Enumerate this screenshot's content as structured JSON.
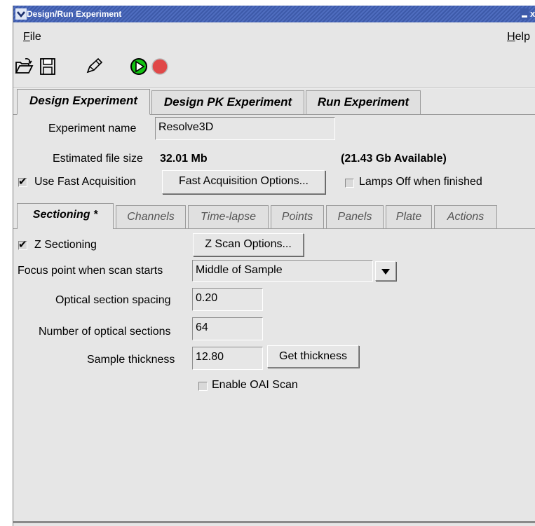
{
  "window": {
    "title": "Design/Run Experiment"
  },
  "menu": {
    "file": "File",
    "help": "Help"
  },
  "toolbar": {
    "icons": [
      "open-folder-icon",
      "save-icon",
      "edit-pen-icon",
      "play-icon",
      "record-stop-icon"
    ]
  },
  "main_tabs": [
    {
      "label": "Design Experiment",
      "active": true
    },
    {
      "label": "Design PK Experiment",
      "active": false
    },
    {
      "label": "Run Experiment",
      "active": false
    }
  ],
  "experiment": {
    "name_label": "Experiment name",
    "name_value": "Resolve3D",
    "size_label": "Estimated file size",
    "size_value": "32.01 Mb",
    "available": "(21.43 Gb Available)",
    "fast_acq_label": "Use Fast Acquisition",
    "fast_acq_checked": true,
    "fast_acq_options": "Fast Acquisition Options...",
    "lamps_off_label": "Lamps Off when finished",
    "lamps_off_checked": false
  },
  "sub_tabs": [
    {
      "label": "Sectioning *",
      "active": true
    },
    {
      "label": "Channels",
      "active": false
    },
    {
      "label": "Time-lapse",
      "active": false
    },
    {
      "label": "Points",
      "active": false
    },
    {
      "label": "Panels",
      "active": false
    },
    {
      "label": "Plate",
      "active": false
    },
    {
      "label": "Actions",
      "active": false
    }
  ],
  "sectioning": {
    "z_sectioning_label": "Z Sectioning",
    "z_sectioning_checked": true,
    "z_scan_options": "Z Scan Options...",
    "focus_label": "Focus point when scan starts",
    "focus_value": "Middle of Sample",
    "spacing_label": "Optical section spacing",
    "spacing_value": "0.20",
    "num_sections_label": "Number of optical sections",
    "num_sections_value": "64",
    "thickness_label": "Sample thickness",
    "thickness_value": "12.80",
    "get_thickness": "Get thickness",
    "oai_label": "Enable OAI Scan",
    "oai_checked": false
  }
}
